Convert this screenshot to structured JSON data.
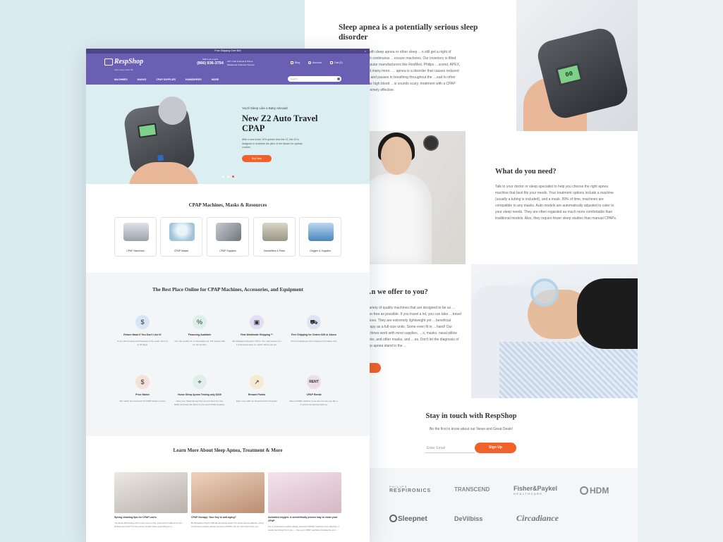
{
  "right": {
    "intro": {
      "title": "Sleep apnea is a potentially serious sleep disorder",
      "body": "…been diagnosed with sleep apnea or other sleep …n still get a night of restorative sleep with continuous …essure machines. Our inventory is filled with best … from popular manufacturers like ResMed, Philips …scend, APEX, Fisher & Paykel, and many more. … apnea is a disorder that causes reduced oxygen …w breaths and pauses in breathing throughout the …ead to other health issues such as high blood …is sounds scary, treatment with a CPAP machine has … extremely effective.",
      "device_readout": "00"
    },
    "needs": {
      "title": "What do you need?",
      "body": "Talk to your doctor or sleep specialist to help you choose the right apnea machine that best fits your needs. Your treatment options include a machine (usually a tubing is included), and a mask. 99% of time, machines are compatible to any masks. Auto models are automatically adjusted to cater to your sleep needs. They are often regarded as much more comfortable than traditional models. Also, they require fewer sleep studies than manual CPAPs."
    },
    "offer": {
      "title": "…n we offer to you?",
      "body": "…variety of quality machines that are designed to be as …noise-free as possible. If you travel a lot, you can take …travel devices. They are extremely lightweight yet …beneficial therapy as a full-size units. Some even fit in …hand! Our machines work with most supplies, …s, masks, nasal pillow masks, and other masks, and …es. Don't let the diagnosis of sleep apnea stand in the …"
    },
    "newsletter": {
      "title": "Stay in touch with RespShop",
      "subtitle": "Be the first to know about our News and Great Deals!",
      "email_placeholder": "Enter Email",
      "signup_label": "Sign Up"
    },
    "brands": {
      "philips": "PHILIPS",
      "respironics": "RESPIRONICS",
      "transcend": "TRANSCEND",
      "fisher_paykel": "Fisher&Paykel",
      "healthcare": "HEALTHCARE",
      "hdm": "HDM",
      "sleepnet": "Sleepnet",
      "devilbiss": "DeVilbiss",
      "circadiance": "Circadiance"
    }
  },
  "site": {
    "topbar": "Free Shipping Over $49",
    "close": "×",
    "brand": "RespShop",
    "brand_tag": "better sleep, better life",
    "phone_label": "Talk to an expert",
    "phone": "(866) 936-3754",
    "hours_1": "24/7 Chat & Email & Phone",
    "hours_2": "Weekends Customer Service",
    "links": [
      {
        "label": "Blog"
      },
      {
        "label": "Account"
      },
      {
        "label": "Cart (0)"
      }
    ],
    "nav": [
      "MACHINES",
      "MASKS",
      "CPAP SUPPLIES",
      "HUMIDIFIERS",
      "MORE"
    ],
    "search_placeholder": "Search",
    "hero": {
      "kicker": "You'll Sleep Like a Baby Abroad!",
      "title": "New Z2 Auto Travel CPAP",
      "body": "With a new motor 10% quieter than the Z1, the Z2 is designed to minimize the pitch of the blower for optimal comfort.",
      "cta": "Buy Now"
    },
    "categories": {
      "title": "CPAP Machines, Masks & Resources",
      "items": [
        "CPAP Machines",
        "CPAP Masks",
        "CPAP Supplies",
        "Humidifiers & Parts",
        "Oxygen & Supplies"
      ]
    },
    "why": {
      "title": "The Best Place Online for CPAP Machines, Accessories, and Equipment",
      "features": [
        {
          "title": "Return Mask if You Don't Like It!",
          "body": "If you cannot sleep well because of the mask, return it in 30 days!"
        },
        {
          "title": "Financing Available",
          "body": "You may qualify for no downpayment, 0% interest rate for 12 months!"
        },
        {
          "title": "Fast Worldwide Shipping **",
          "body": "All packages shipped in 24hrs. You may receive it in 1-2 business days no matter where you are."
        },
        {
          "title": "Free Shipping for Orders $49 or Above",
          "body": "Ground shipping to 48 contiguous US states only"
        },
        {
          "title": "Price Match",
          "body": "We match any licensed US CPAP dealers' prices"
        },
        {
          "title": "Home Sleep Apnea Testing only $349",
          "body": "Have your Sleep Apnea Test at your home for only $349, and have Rx deliver if you need CPAP supplies."
        },
        {
          "title": "Reward Points",
          "body": "Earn more with our Reward Points Program"
        },
        {
          "title": "CPAP Rental",
          "body": "Rent a CPAP machine if you are not sure you like it, or just for temporary back up."
        }
      ]
    },
    "learn": {
      "title": "Learn More About Sleep Apnea, Treatment & More",
      "posts": [
        {
          "title": "Spring cleaning tips for CPAP users",
          "body": "You know that feeling when your room is tidy, your bed is made and your clothes are fresh? It's the sense of calm when everything is in…"
        },
        {
          "title": "CPAP therapy: Your key to anti-aging?",
          "body": "By Bangalore Taylor Talk about beauty sleep! For sleep apnea patients, using continuous positive airway pressure (CPAP) can do more than help you…"
        },
        {
          "title": "Activated oxygen: A scientifically proven way to clean your CPAP",
          "body": "For a continuous positive airway pressure (CPAP) machine to be effective, it needs two things from you — Use your CPAP machine consistently, as p…"
        }
      ]
    }
  }
}
